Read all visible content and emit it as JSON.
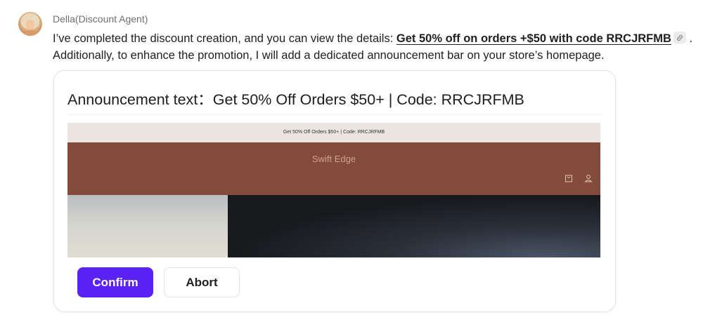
{
  "message": {
    "sender": "Della(Discount Agent)",
    "text_before_link": "I’ve completed the discount creation, and you can view the details: ",
    "link_text": "Get 50% off on orders +$50 with code RRCJRFMB",
    "text_after_link": " .",
    "text_second_line": "Additionally, to enhance the promotion, I will add a dedicated announcement bar on your store’s homepage.",
    "link_icon": "link-icon"
  },
  "card": {
    "title": "Announcement text：Get 50% Off Orders $50+ | Code: RRCJRFMB",
    "preview": {
      "announcement_bar_text": "Get 50% Off Orders $50+ | Code: RRCJRFMB",
      "store_name": "Swift Edge",
      "header_icons": [
        "bag-icon",
        "user-icon"
      ],
      "header_color": "#824b3b",
      "announcement_bg": "#ece6e2"
    },
    "confirm_label": "Confirm",
    "abort_label": "Abort",
    "accent_color": "#5b22f5"
  }
}
